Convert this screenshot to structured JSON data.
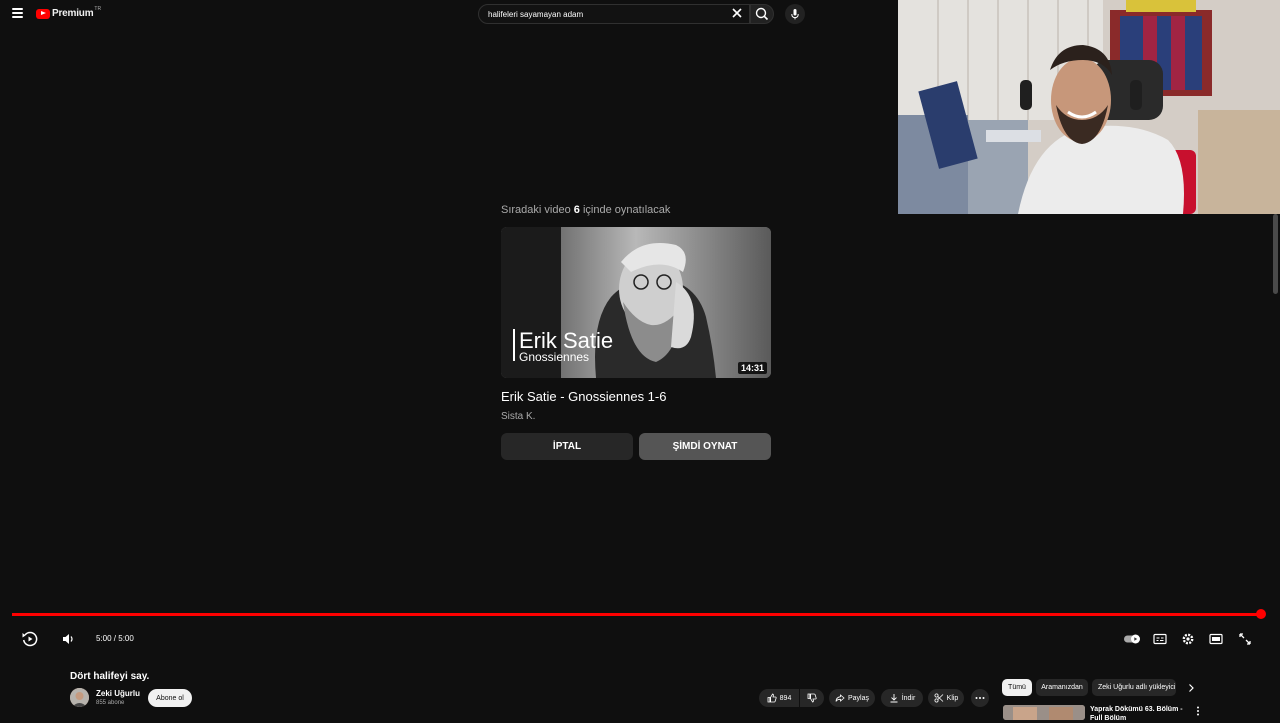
{
  "header": {
    "logo_text": "Premium",
    "logo_region": "TR",
    "search_value": "halifeleri sayamayan adam"
  },
  "endscreen": {
    "next_prefix": "Sıradaki video ",
    "next_seconds": "6",
    "next_suffix": " içinde oynatılacak",
    "thumbnail_text_line1": "Erik Satie",
    "thumbnail_text_line2": "Gnossiennes",
    "duration": "14:31",
    "video_title": "Erik Satie - Gnossiennes 1-6",
    "channel": "Sista K.",
    "cancel_label": "İPTAL",
    "play_now_label": "ŞİMDİ OYNAT"
  },
  "player": {
    "progress_fraction": 1.0,
    "time_display": "5:00 / 5:00"
  },
  "video_info": {
    "title": "Dört halifeyi say.",
    "channel_name": "Zeki Uğurlu",
    "subscribers": "855 abone",
    "subscribe_label": "Abone ol",
    "like_count": "894",
    "share_label": "Paylaş",
    "download_label": "İndir",
    "clip_label": "Klip"
  },
  "sidebar": {
    "chips": [
      "Tümü",
      "Aramanızdan",
      "Zeki Uğurlu adlı yükleyici"
    ],
    "recommendation_title": "Yaprak Dökümü 63. Bölüm - Full Bölüm"
  },
  "colors": {
    "accent": "#ff0000",
    "background": "#0f0f0f"
  },
  "icons": [
    "menu-icon",
    "youtube-logo-icon",
    "close-icon",
    "search-icon",
    "mic-icon",
    "replay-icon",
    "volume-icon",
    "autoplay-toggle-icon",
    "subtitles-icon",
    "settings-icon",
    "miniplayer-icon",
    "fullscreen-icon",
    "like-icon",
    "dislike-icon",
    "share-icon",
    "download-icon",
    "clip-icon",
    "more-icon",
    "chevron-right-icon"
  ]
}
